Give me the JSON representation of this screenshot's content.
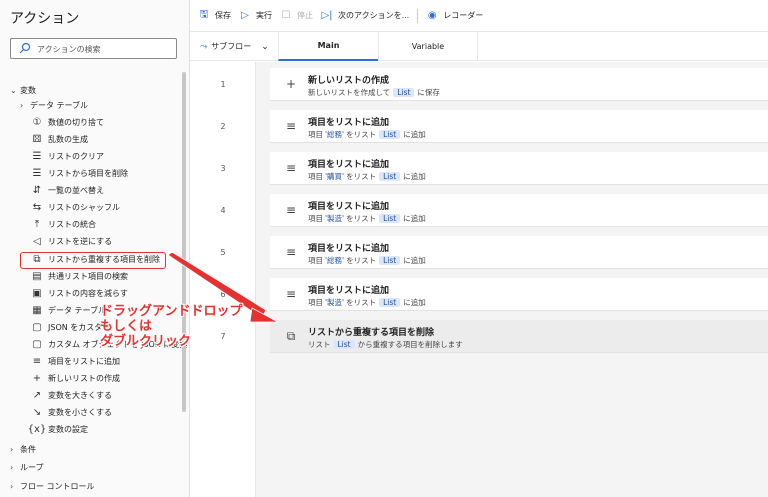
{
  "actions_panel": {
    "title": "アクション",
    "search_placeholder": "アクションの検索",
    "groups": [
      {
        "label": "変数",
        "expanded": true
      },
      {
        "label": "データ テーブル",
        "expanded": false
      },
      {
        "label": "条件",
        "expanded": false
      },
      {
        "label": "ループ",
        "expanded": false
      },
      {
        "label": "フロー コントロール",
        "expanded": false
      }
    ],
    "items": [
      {
        "label": "数値の切り捨て",
        "icon": "round-number-icon"
      },
      {
        "label": "乱数の生成",
        "icon": "dice-icon"
      },
      {
        "label": "リストのクリア",
        "icon": "list-icon"
      },
      {
        "label": "リストから項目を削除",
        "icon": "list-remove-icon"
      },
      {
        "label": "一覧の並べ替え",
        "icon": "sort-icon"
      },
      {
        "label": "リストのシャッフル",
        "icon": "shuffle-icon"
      },
      {
        "label": "リストの統合",
        "icon": "merge-icon"
      },
      {
        "label": "リストを逆にする",
        "icon": "reverse-icon"
      },
      {
        "label": "リストから重複する項目を削除",
        "icon": "remove-duplicates-icon"
      },
      {
        "label": "共通リスト項目の検索",
        "icon": "common-items-icon"
      },
      {
        "label": "リストの内容を減らす",
        "icon": "subtract-list-icon"
      },
      {
        "label": "データ テーブル",
        "icon": "datatable-icon"
      },
      {
        "label": "JSON をカスタム",
        "icon": "json-icon"
      },
      {
        "label": "カスタム オブジェクトを JSON に変換",
        "icon": "object-json-icon"
      },
      {
        "label": "項目をリストに追加",
        "icon": "add-item-icon"
      },
      {
        "label": "新しいリストの作成",
        "icon": "plus-icon"
      },
      {
        "label": "変数を大きくする",
        "icon": "increase-icon"
      },
      {
        "label": "変数を小さくする",
        "icon": "decrease-icon"
      },
      {
        "label": "変数の設定",
        "icon": "variable-icon"
      }
    ]
  },
  "toolbar": {
    "save": "保存",
    "run": "実行",
    "stop": "停止",
    "next": "次のアクションを...",
    "recorder": "レコーダー"
  },
  "tabs": {
    "subflow": "サブフロー",
    "main": "Main",
    "variable": "Variable"
  },
  "steps": [
    {
      "num": "1",
      "title": "新しいリストの作成",
      "pre": "新しいリストを作成して",
      "chip": "List",
      "post": "に保存",
      "icon": "plus-icon"
    },
    {
      "num": "2",
      "title": "項目をリストに追加",
      "pre": "項目",
      "value": "'総務'",
      "mid": "をリスト",
      "chip": "List",
      "post": "に追加",
      "icon": "add-item-icon"
    },
    {
      "num": "3",
      "title": "項目をリストに追加",
      "pre": "項目",
      "value": "'購買'",
      "mid": "をリスト",
      "chip": "List",
      "post": "に追加",
      "icon": "add-item-icon"
    },
    {
      "num": "4",
      "title": "項目をリストに追加",
      "pre": "項目",
      "value": "'製造'",
      "mid": "をリスト",
      "chip": "List",
      "post": "に追加",
      "icon": "add-item-icon"
    },
    {
      "num": "5",
      "title": "項目をリストに追加",
      "pre": "項目",
      "value": "'総務'",
      "mid": "をリスト",
      "chip": "List",
      "post": "に追加",
      "icon": "add-item-icon"
    },
    {
      "num": "6",
      "title": "項目をリストに追加",
      "pre": "項目",
      "value": "'製造'",
      "mid": "をリスト",
      "chip": "List",
      "post": "に追加",
      "icon": "add-item-icon"
    },
    {
      "num": "7",
      "title": "リストから重複する項目を削除",
      "pre": "リスト",
      "chip": "List",
      "post": "から重複する項目を削除します",
      "icon": "remove-duplicates-icon"
    }
  ],
  "annotation": {
    "line1": "ドラッグアンドドロップ",
    "line2": "もしくは",
    "line3": "ダブルクリック",
    "color": "#e5312f"
  }
}
